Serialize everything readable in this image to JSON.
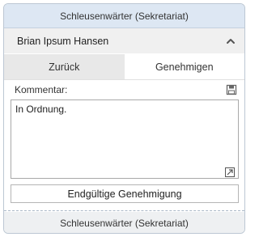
{
  "header": {
    "title": "Schleusenwärter (Sekretariat)"
  },
  "user": {
    "name": "Brian Ipsum Hansen",
    "toggle_icon": "chevron-up-icon"
  },
  "actions": {
    "back_label": "Zurück",
    "approve_label": "Genehmigen"
  },
  "comment": {
    "label": "Kommentar:",
    "value": "In Ordnung.",
    "save_icon": "save-icon",
    "expand_icon": "expand-icon"
  },
  "final_button": {
    "label": "Endgültige Genehmigung"
  },
  "footer": {
    "title": "Schleusenwärter (Sekretariat)"
  },
  "colors": {
    "header_bg": "#dde7f3",
    "border": "#bcc7d3"
  }
}
